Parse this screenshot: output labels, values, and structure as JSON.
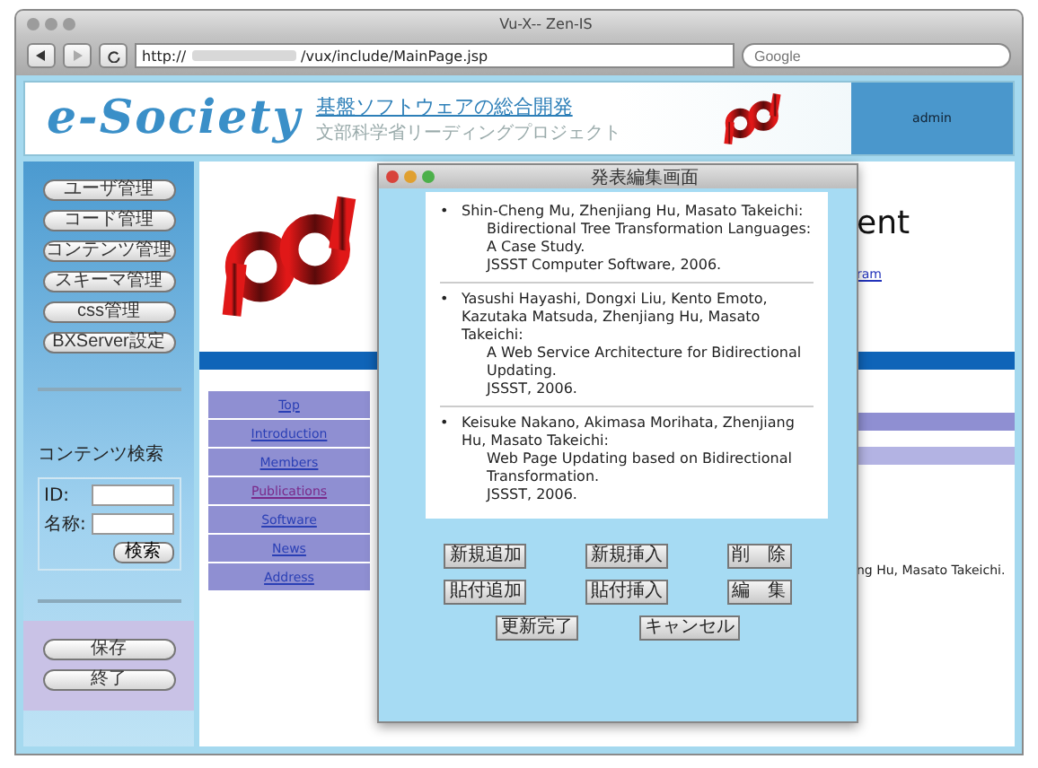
{
  "browser": {
    "title": "Vu-X-- Zen-IS",
    "url_scheme": "http://",
    "url_path": "/vux/include/MainPage.jsp",
    "search_placeholder": "Google"
  },
  "header": {
    "logo": "e-Society",
    "title": "基盤ソフトウェアの総合開発",
    "subtitle": "文部科学省リーディングプロジェクト",
    "user": "admin"
  },
  "sidebar": {
    "menu": [
      "ユーザ管理",
      "コード管理",
      "コンテンツ管理",
      "スキーマ管理",
      "css管理",
      "BXServer設定"
    ],
    "search": {
      "title": "コンテンツ検索",
      "fields": [
        {
          "label": "ID:"
        },
        {
          "label": "名称:"
        }
      ],
      "button": "検索"
    },
    "actions": [
      "保存",
      "終了"
    ]
  },
  "nav": [
    {
      "label": "Top",
      "visited": false
    },
    {
      "label": "Introduction",
      "visited": false
    },
    {
      "label": "Members",
      "visited": false
    },
    {
      "label": "Publications",
      "visited": true
    },
    {
      "label": "Software",
      "visited": false
    },
    {
      "label": "News",
      "visited": false
    },
    {
      "label": "Address",
      "visited": false
    }
  ],
  "page": {
    "heading": "ent",
    "link": "ram",
    "text": "ng Hu, Masato Takeichi."
  },
  "dialog": {
    "title": "発表編集画面",
    "publications": [
      {
        "bullet": "•",
        "authors": "Shin-Cheng Mu, Zhenjiang Hu, Masato Takeichi:",
        "title": "Bidirectional Tree Transformation Languages: A Case Study.",
        "venue": "JSSST Computer Software, 2006."
      },
      {
        "bullet": "•",
        "authors": "Yasushi Hayashi, Dongxi Liu, Kento Emoto, Kazutaka Matsuda, Zhenjiang Hu, Masato Takeichi:",
        "title": "A Web Service Architecture for Bidirectional Updating.",
        "venue": "JSSST, 2006."
      },
      {
        "bullet": "•",
        "authors": "Keisuke Nakano, Akimasa Morihata, Zhenjiang Hu, Masato Takeichi:",
        "title": "Web Page Updating based on Bidirectional Transformation.",
        "venue": "JSSST, 2006."
      }
    ],
    "buttons": [
      [
        "新規追加",
        "新規挿入",
        "削　除"
      ],
      [
        "貼付追加",
        "貼付挿入",
        "編　集"
      ],
      [
        "更新完了",
        "キャンセル"
      ]
    ]
  }
}
